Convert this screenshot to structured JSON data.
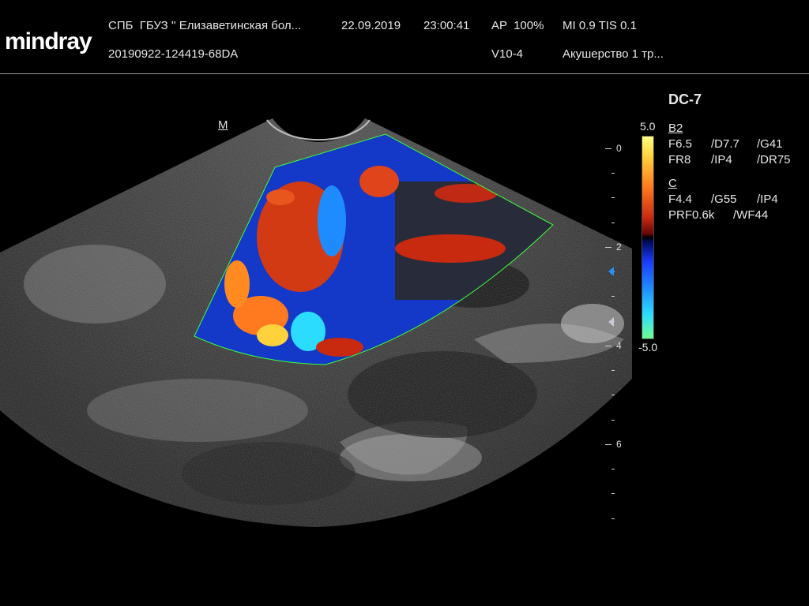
{
  "header": {
    "logo": "mindray",
    "institution": "СПБ  ГБУЗ '' Елизаветинская бол...",
    "date": "22.09.2019",
    "time": "23:00:41",
    "ap": "AP  100%",
    "mi_tis": "MI 0.9 TIS 0.1",
    "exam_id": "20190922-124419-68DA",
    "probe": "V10-4",
    "preset": "Акушерство 1 тр..."
  },
  "panel": {
    "title": "DC-7",
    "b_mode": {
      "label": "B2",
      "row1": [
        "F6.5",
        "/D7.7",
        "/G41"
      ],
      "row2": [
        "FR8",
        "/IP4",
        "/DR75"
      ]
    },
    "color": {
      "label": "C",
      "row1": [
        "F4.4",
        "/G55",
        "/IP4"
      ],
      "row2": [
        "PRF0.6k",
        "/WF44"
      ]
    }
  },
  "color_scale": {
    "max": "5.0",
    "min": "-5.0"
  },
  "orientation_marker": "M",
  "depth_scale": [
    "0",
    "2",
    "4",
    "6"
  ],
  "colors": {
    "background": "#000000",
    "text": "#e6e6e6",
    "roi_border": "#3cff3c"
  }
}
